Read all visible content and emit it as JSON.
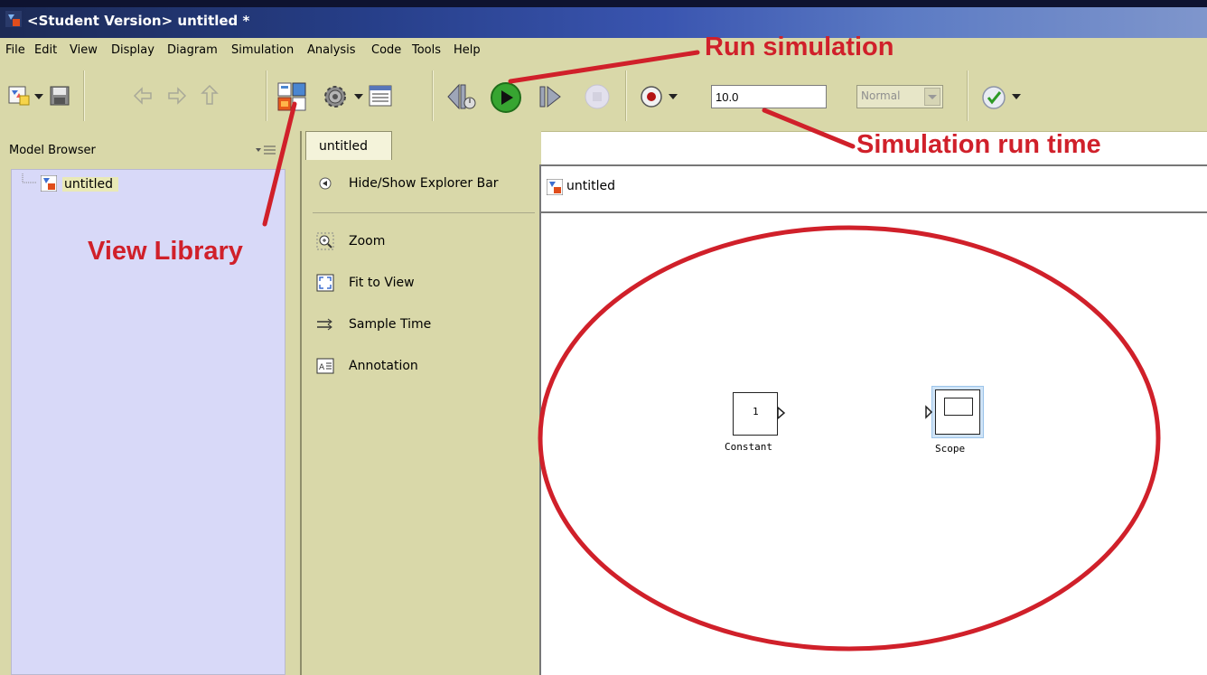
{
  "window": {
    "title": "<Student Version> untitled *"
  },
  "menu": [
    "File",
    "Edit",
    "View",
    "Display",
    "Diagram",
    "Simulation",
    "Analysis",
    "Code",
    "Tools",
    "Help"
  ],
  "toolbar": {
    "stop_time": "10.0",
    "sim_mode": "Normal"
  },
  "model_browser": {
    "title": "Model Browser",
    "tree_root": "untitled"
  },
  "editor": {
    "tab": "untitled",
    "explorer": {
      "toggle": "Hide/Show Explorer Bar",
      "items": [
        "Zoom",
        "Fit to View",
        "Sample Time",
        "Annotation"
      ]
    },
    "breadcrumb": "untitled"
  },
  "diagram": {
    "blocks": [
      {
        "name": "Constant",
        "value": "1"
      },
      {
        "name": "Scope"
      }
    ]
  },
  "annotations": {
    "run_simulation": "Run simulation",
    "view_library": "View Library",
    "simulation_run_time": "Simulation run time",
    "color": "#d0202a"
  }
}
